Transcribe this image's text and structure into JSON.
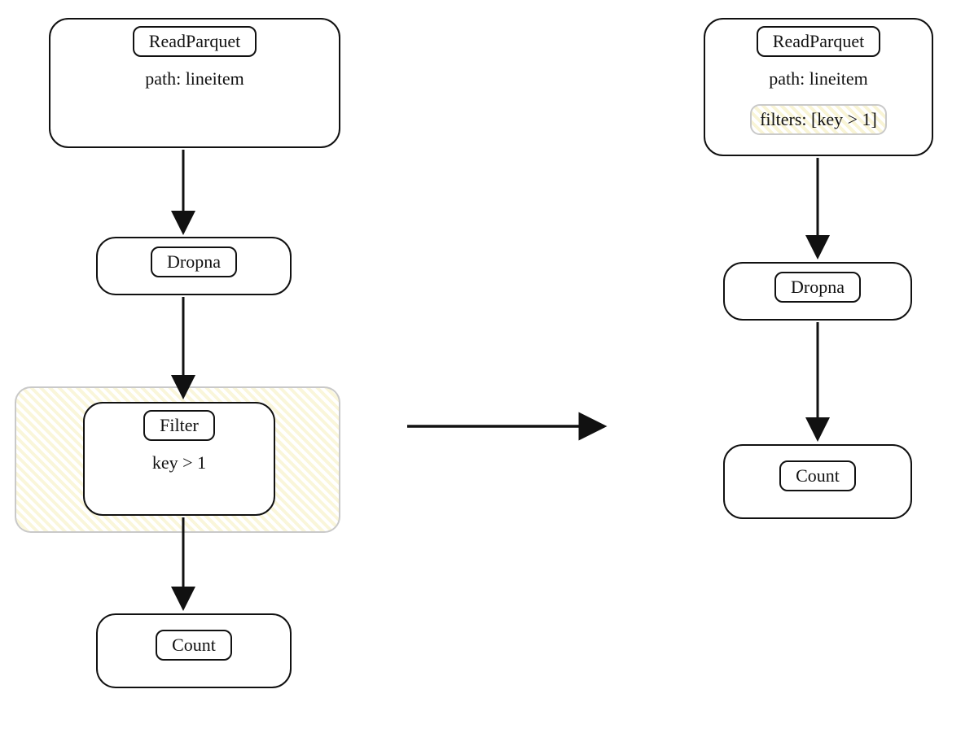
{
  "left": {
    "read": {
      "title": "ReadParquet",
      "path_line": "path: lineitem"
    },
    "drop": {
      "title": "Dropna"
    },
    "filter": {
      "title": "Filter",
      "predicate": "key > 1"
    },
    "count": {
      "title": "Count"
    }
  },
  "right": {
    "read": {
      "title": "ReadParquet",
      "path_line": "path: lineitem",
      "filters_line": "filters: [key > 1]"
    },
    "drop": {
      "title": "Dropna"
    },
    "count": {
      "title": "Count"
    }
  },
  "edges": {
    "left": [
      "read→drop",
      "drop→filter",
      "filter→count"
    ],
    "center_transform": "left→right",
    "right": [
      "read→drop",
      "drop→count"
    ]
  }
}
